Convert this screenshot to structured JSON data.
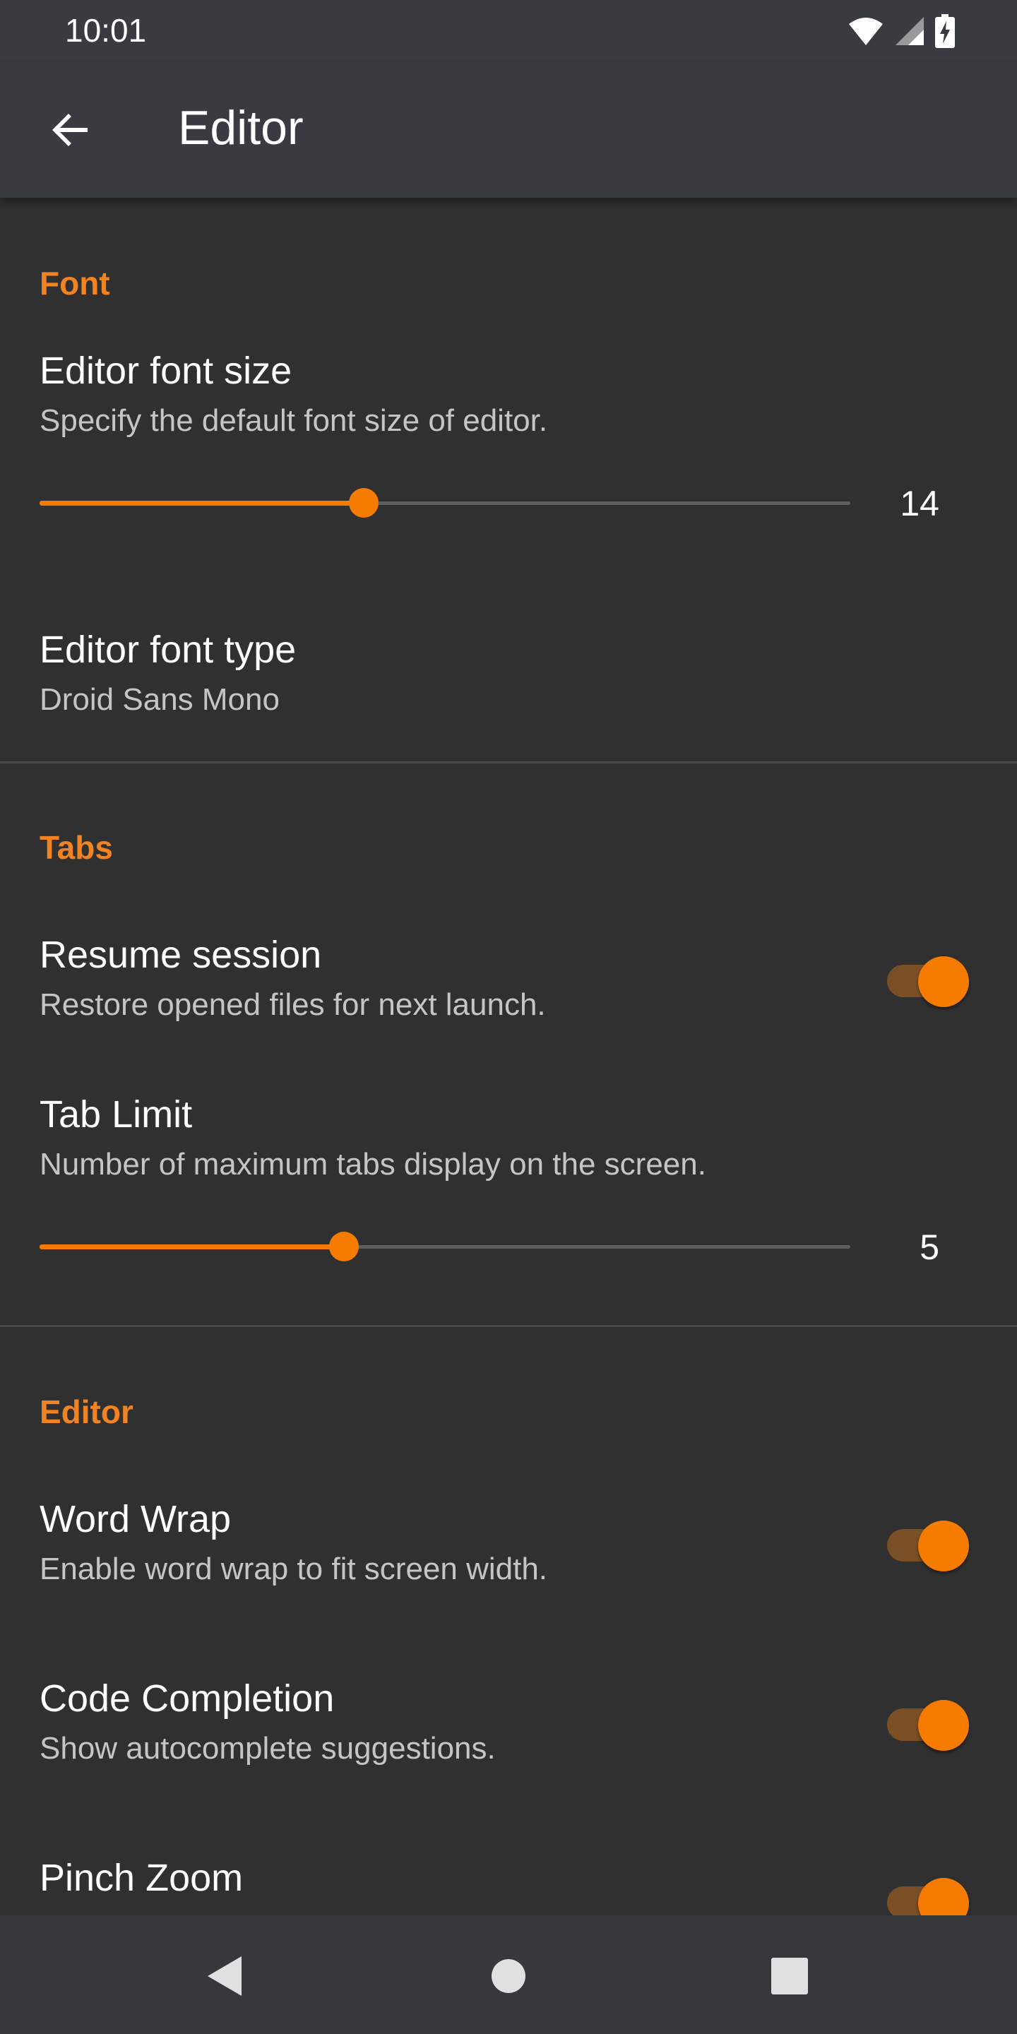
{
  "status_bar": {
    "time": "10:01",
    "icons": [
      "wifi-icon",
      "signal-icon",
      "battery-charging-icon"
    ]
  },
  "app_bar": {
    "back_icon": "arrow-left-icon",
    "title": "Editor"
  },
  "colors": {
    "accent": "#f57c00",
    "section_header": "#f28322",
    "background": "#303030",
    "toolbar": "#383b3f"
  },
  "sections": {
    "font": {
      "header": "Font",
      "font_size": {
        "title": "Editor font size",
        "summary": "Specify the default font size of editor.",
        "value": "14",
        "fraction": 0.4
      },
      "font_type": {
        "title": "Editor font type",
        "summary": "Droid Sans Mono"
      }
    },
    "tabs": {
      "header": "Tabs",
      "resume_session": {
        "title": "Resume session",
        "summary": "Restore opened files for next launch.",
        "checked": true
      },
      "tab_limit": {
        "title": "Tab Limit",
        "summary": "Number of maximum tabs display on the screen.",
        "value": "5",
        "fraction": 0.375
      }
    },
    "editor": {
      "header": "Editor",
      "word_wrap": {
        "title": "Word Wrap",
        "summary": "Enable word wrap to fit screen width.",
        "checked": true
      },
      "code_completion": {
        "title": "Code Completion",
        "summary": "Show autocomplete suggestions.",
        "checked": true
      },
      "pinch_zoom": {
        "title": "Pinch Zoom",
        "checked": true
      }
    }
  },
  "nav_bar": {
    "back": "nav-back-icon",
    "home": "nav-home-icon",
    "recents": "nav-recents-icon"
  }
}
